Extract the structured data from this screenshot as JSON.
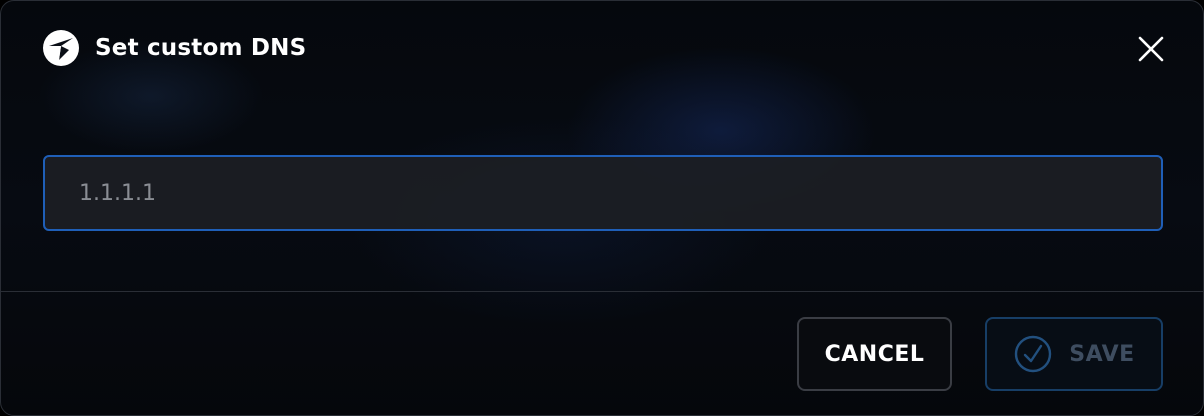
{
  "dialog": {
    "title": "Set custom DNS",
    "logo_icon": "app-logo-icon",
    "close_icon": "close-icon"
  },
  "dns_field": {
    "value": "1.1.1.1",
    "placeholder": ""
  },
  "actions": {
    "cancel_label": "CANCEL",
    "save_label": "SAVE",
    "save_icon": "check-circle-icon",
    "save_enabled": false
  },
  "colors": {
    "accent": "#1f5fb8",
    "save_disabled_text": "#3e4d60",
    "save_disabled_border": "#173e66"
  }
}
